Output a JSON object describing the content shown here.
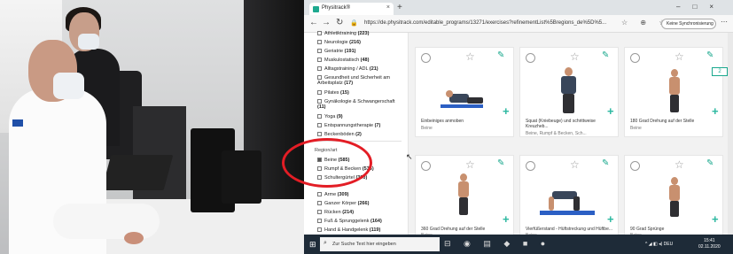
{
  "browser": {
    "tab_title": "Physitrack®",
    "new_tab": "+",
    "tab_close": "×",
    "window_controls": "–□×",
    "url": "https://de.physitrack.com/editable_programs/13271/exercises?refinementList%5Bregions_de%5D%5...",
    "sync_button": "Keine Synchronisierung",
    "nav": {
      "back": "←",
      "forward": "→",
      "reload": "↻",
      "lock": "🔒",
      "more": "⋯"
    },
    "toolbar_icons": "☆ ⊕ ☆ ⧉"
  },
  "filters": {
    "categories": [
      {
        "label": "Athletiktraining",
        "count": "(223)"
      },
      {
        "label": "Neurologie",
        "count": "(216)"
      },
      {
        "label": "Geriatrie",
        "count": "(191)"
      },
      {
        "label": "Muskulostatisch",
        "count": "(48)"
      },
      {
        "label": "Alltagstraining / ADL",
        "count": "(21)"
      },
      {
        "label": "Gesundheit und Sicherheit am Arbeitsplatz",
        "count": "(17)"
      },
      {
        "label": "Pilates",
        "count": "(15)"
      },
      {
        "label": "Gynäkologie & Schwangerschaft",
        "count": "(11)"
      },
      {
        "label": "Yoga",
        "count": "(9)"
      },
      {
        "label": "Entspannungstherapie",
        "count": "(7)"
      },
      {
        "label": "Beckenböden",
        "count": "(2)"
      }
    ],
    "region_heading": "Region/art",
    "regions": [
      {
        "label": "Beine",
        "count": "(585)",
        "checked": true
      },
      {
        "label": "Rumpf & Becken",
        "count": "(536)",
        "checked": false
      },
      {
        "label": "Schultergürtel",
        "count": "(390)",
        "checked": false
      },
      {
        "label": "Arme",
        "count": "(309)",
        "checked": false
      },
      {
        "label": "Ganzer Körper",
        "count": "(266)",
        "checked": false
      },
      {
        "label": "Rücken",
        "count": "(214)",
        "checked": false
      },
      {
        "label": "Fuß & Sprunggelenk",
        "count": "(164)",
        "checked": false
      },
      {
        "label": "Hand & Handgelenk",
        "count": "(119)",
        "checked": false
      }
    ]
  },
  "exercises": {
    "row1": [
      {
        "title": "Einbeiniges anmoben",
        "sub": "Beine"
      },
      {
        "title": "Squat (Kniebeuge) und schrittweise Kreuzheb...",
        "sub": "Beine, Rumpf & Becken, Sch..."
      },
      {
        "title": "180 Grad Drehung auf der Stelle",
        "sub": "Beine",
        "badge": "2"
      }
    ],
    "row2": [
      {
        "title": "360 Grad Drehung auf der Stelle",
        "sub": "Beine"
      },
      {
        "title": "Vierfüßerstand - Hüftstreckung und Hüftbe...",
        "sub": "Beine"
      },
      {
        "title": "90 Grad Sprünge",
        "sub": "Beine"
      }
    ],
    "icons": {
      "star": "☆",
      "edit": "✎",
      "plus": "+"
    }
  },
  "taskbar": {
    "start": "⊞",
    "search_glyph": "⌕",
    "search_placeholder": "Zur Suche Text hier eingeben",
    "apps": "⊟ ◉ ▤ ◆ ■ ●",
    "tray": "^ ◢ ◧ ◂) DEU",
    "time": "15:41",
    "date": "02.11.2020"
  },
  "colors": {
    "accent": "#19a88d",
    "annotation_red": "#e31d25",
    "taskbar": "#1e2b38"
  }
}
